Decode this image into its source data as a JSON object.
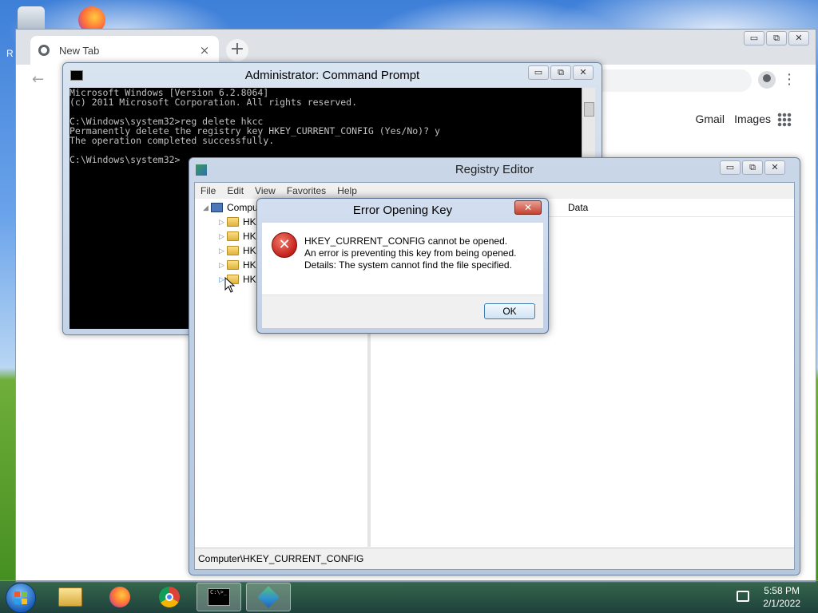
{
  "desktop": {
    "partial_label": "R"
  },
  "chrome": {
    "tab_title": "New Tab",
    "tab_close": "×",
    "new_tab": "+",
    "back": "←",
    "menu": "⋮",
    "links": [
      "Gmail",
      "Images"
    ],
    "window_controls": [
      "▭",
      "⧉",
      "✕"
    ]
  },
  "cmd": {
    "title": "Administrator: Command Prompt",
    "lines": [
      "Microsoft Windows [Version 6.2.8064]",
      "(c) 2011 Microsoft Corporation. All rights reserved.",
      "",
      "C:\\Windows\\system32>reg delete hkcc",
      "Permanently delete the registry key HKEY_CURRENT_CONFIG (Yes/No)? y",
      "The operation completed successfully.",
      "",
      "C:\\Windows\\system32>"
    ],
    "window_controls": [
      "▭",
      "⧉",
      "✕"
    ]
  },
  "regedit": {
    "title": "Registry Editor",
    "menus": [
      "File",
      "Edit",
      "View",
      "Favorites",
      "Help"
    ],
    "tree_root": "Compu",
    "tree_items": [
      "HKE",
      "HKE",
      "HKE",
      "HKE",
      "HKE"
    ],
    "columns": {
      "data": "Data"
    },
    "status": "Computer\\HKEY_CURRENT_CONFIG",
    "window_controls": [
      "▭",
      "⧉",
      "✕"
    ]
  },
  "error_dialog": {
    "title": "Error Opening Key",
    "close": "✕",
    "icon_glyph": "✕",
    "messages": [
      "HKEY_CURRENT_CONFIG cannot be opened.",
      "An error is preventing this key from being opened.",
      "Details: The system cannot find the file specified."
    ],
    "ok_label": "OK"
  },
  "taskbar": {
    "cmd_icon_text": "C:\\>_",
    "clock_time": "5:58 PM",
    "clock_date": "2/1/2022"
  }
}
